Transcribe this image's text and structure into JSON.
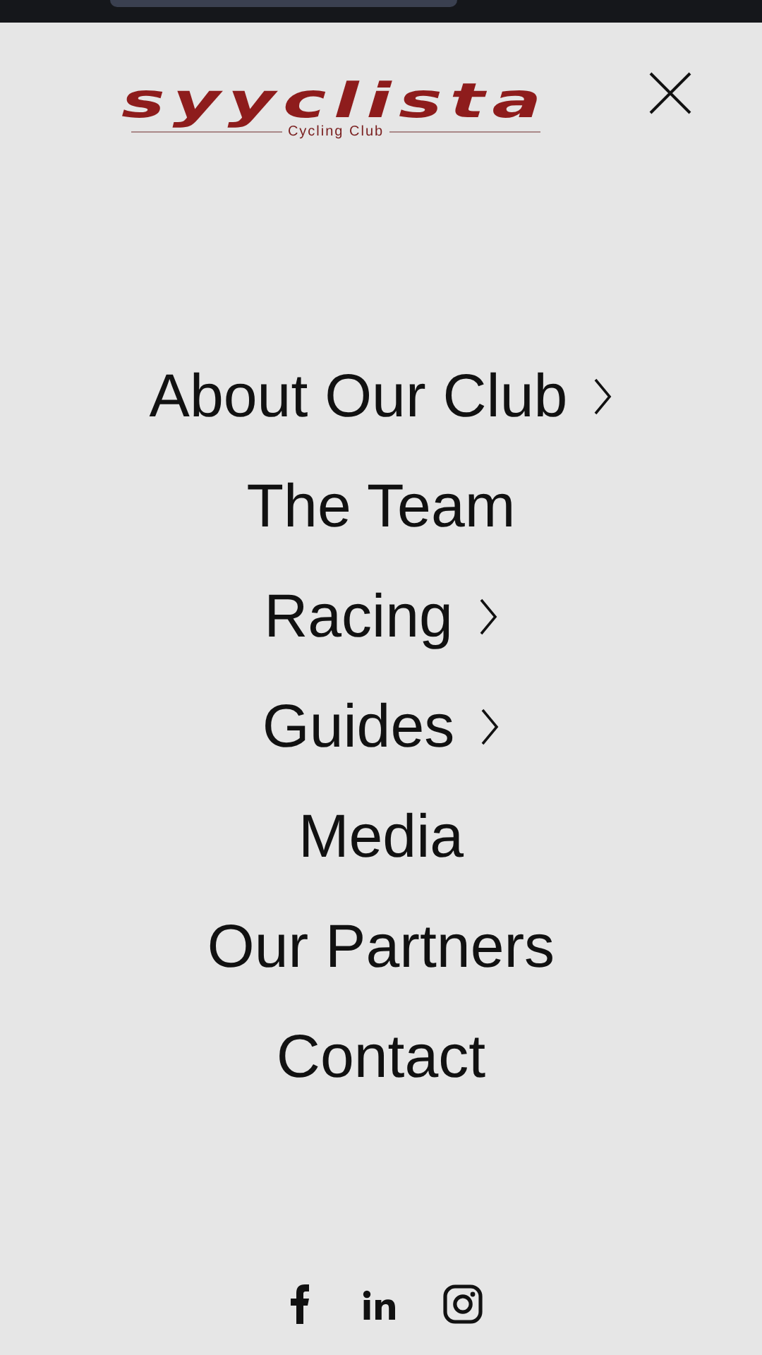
{
  "logo": {
    "name": "syyclista",
    "tagline": "Cycling Club"
  },
  "menu": [
    {
      "label": "About Our Club",
      "has_submenu": true
    },
    {
      "label": "The Team",
      "has_submenu": false
    },
    {
      "label": "Racing",
      "has_submenu": true
    },
    {
      "label": "Guides",
      "has_submenu": true
    },
    {
      "label": "Media",
      "has_submenu": false
    },
    {
      "label": "Our Partners",
      "has_submenu": false
    },
    {
      "label": "Contact",
      "has_submenu": false
    }
  ],
  "social": [
    {
      "kind": "facebook"
    },
    {
      "kind": "linkedin"
    },
    {
      "kind": "instagram"
    }
  ]
}
